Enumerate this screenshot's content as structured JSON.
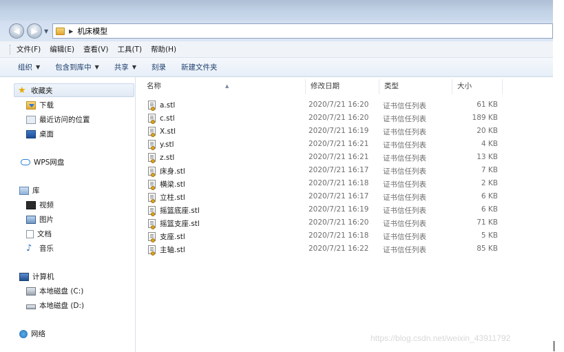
{
  "address": {
    "path": "机床模型"
  },
  "menu": [
    "文件(F)",
    "编辑(E)",
    "查看(V)",
    "工具(T)",
    "帮助(H)"
  ],
  "toolbar": {
    "organize": "组织",
    "include_library": "包含到库中",
    "share": "共享",
    "burn": "刻录",
    "new_folder": "新建文件夹"
  },
  "nav": {
    "favorites": "收藏夹",
    "downloads": "下载",
    "recent": "最近访问的位置",
    "desktop": "桌面",
    "wps": "WPS网盘",
    "libraries": "库",
    "videos": "视频",
    "pictures": "图片",
    "documents": "文档",
    "music": "音乐",
    "computer": "计算机",
    "drive_c": "本地磁盘 (C:)",
    "drive_d": "本地磁盘 (D:)",
    "network": "网络"
  },
  "columns": {
    "name": "名称",
    "date": "修改日期",
    "type": "类型",
    "size": "大小"
  },
  "files": [
    {
      "name": "a.stl",
      "date": "2020/7/21 16:20",
      "type": "证书信任列表",
      "size": "61 KB"
    },
    {
      "name": "c.stl",
      "date": "2020/7/21 16:20",
      "type": "证书信任列表",
      "size": "189 KB"
    },
    {
      "name": "X.stl",
      "date": "2020/7/21 16:19",
      "type": "证书信任列表",
      "size": "20 KB"
    },
    {
      "name": "y.stl",
      "date": "2020/7/21 16:21",
      "type": "证书信任列表",
      "size": "4 KB"
    },
    {
      "name": "z.stl",
      "date": "2020/7/21 16:21",
      "type": "证书信任列表",
      "size": "13 KB"
    },
    {
      "name": "床身.stl",
      "date": "2020/7/21 16:17",
      "type": "证书信任列表",
      "size": "7 KB"
    },
    {
      "name": "横梁.stl",
      "date": "2020/7/21 16:18",
      "type": "证书信任列表",
      "size": "2 KB"
    },
    {
      "name": "立柱.stl",
      "date": "2020/7/21 16:17",
      "type": "证书信任列表",
      "size": "6 KB"
    },
    {
      "name": "摇篮底座.stl",
      "date": "2020/7/21 16:19",
      "type": "证书信任列表",
      "size": "6 KB"
    },
    {
      "name": "摇篮支座.stl",
      "date": "2020/7/21 16:20",
      "type": "证书信任列表",
      "size": "71 KB"
    },
    {
      "name": "支座.stl",
      "date": "2020/7/21 16:18",
      "type": "证书信任列表",
      "size": "5 KB"
    },
    {
      "name": "主轴.stl",
      "date": "2020/7/21 16:22",
      "type": "证书信任列表",
      "size": "85 KB"
    }
  ],
  "watermark": "https://blog.csdn.net/weixin_43911792"
}
